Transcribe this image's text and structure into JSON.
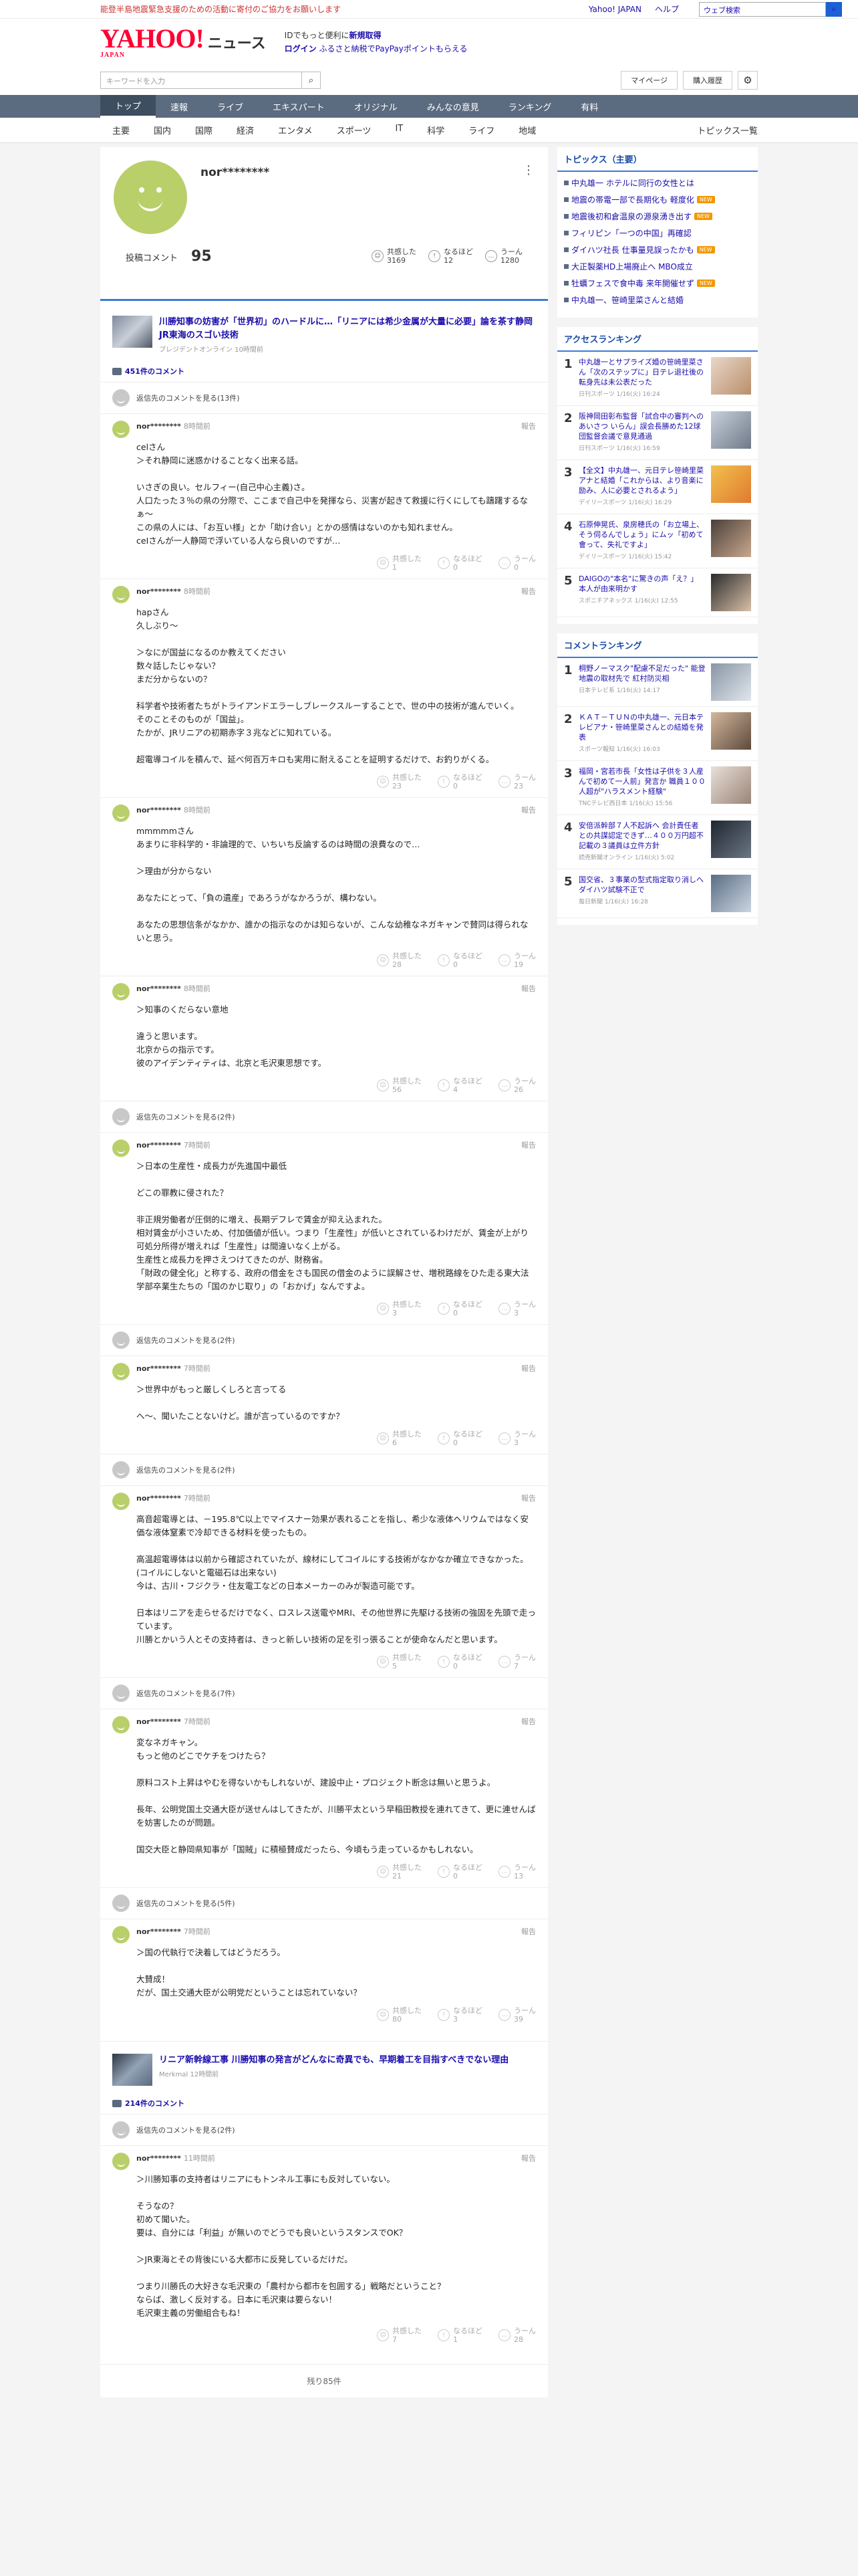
{
  "topbar": {
    "alert": "能登半島地震緊急支援のための活動に寄付のご協力をお願いします",
    "links": [
      "Yahoo! JAPAN",
      "ヘルプ"
    ],
    "search_placeholder": "ウェブ検索"
  },
  "header": {
    "logo": "YAHOO!",
    "logo_sub": "JAPAN",
    "service": "ニュース",
    "promo1": "IDでもっと便利に",
    "promo1b": "新規取得",
    "promo2": "ログイン",
    "promo2b": "ふるさと納税でPayPayポイントもらえる"
  },
  "search": {
    "placeholder": "キーワードを入力",
    "mypage": "マイページ",
    "history": "購入履歴"
  },
  "nav1": [
    "トップ",
    "速報",
    "ライブ",
    "エキスパート",
    "オリジナル",
    "みんなの意見",
    "ランキング",
    "有料"
  ],
  "nav2": [
    "主要",
    "国内",
    "国際",
    "経済",
    "エンタメ",
    "スポーツ",
    "IT",
    "科学",
    "ライフ",
    "地域"
  ],
  "nav2_all": "トピックス一覧",
  "profile": {
    "name": "nor********",
    "posted_label": "投稿コメント",
    "posted": "95",
    "r1": "共感した",
    "r1v": "3169",
    "r2": "なるほど",
    "r2v": "12",
    "r3": "うーん",
    "r3v": "1280"
  },
  "article1": {
    "title": "川勝知事の妨害が「世界初」のハードルに…「リニアには希少金属が大量に必要」論を茶す静岡JR東海のスゴい技術",
    "source": "プレジデントオンライン 10時間前",
    "count": "451件のコメント"
  },
  "parent_label": "返信先のコメントを見る",
  "parents": [
    "(13件)",
    "(2件)",
    "(2件)",
    "(2件)",
    "(7件)",
    "(5件)"
  ],
  "react_labels": [
    "共感した",
    "なるほど",
    "うーん"
  ],
  "report": "報告",
  "comments": [
    {
      "name": "nor********",
      "time": "8時間前",
      "text": "celさん\n＞それ静岡に迷惑かけることなく出来る話。\n\nいさぎの良い。セルフィー(自己中心主義)さ。\n人口たった３％の県の分際で、ここまで自己中を発揮なら、災害が起きて救援に行くにしても躊躇するなぁ〜\nこの県の人には、「お互い様」とか「助け合い」とかの感情はないのかも知れません。\nceIさんが一人静岡で浮いている人なら良いのですが…",
      "r": [
        "1",
        "0",
        "0"
      ]
    },
    {
      "name": "nor********",
      "time": "8時間前",
      "text": "hapさん\n久しぶり〜\n\n＞なにが国益になるのか教えてください\n数々話したじゃない？\nまだ分からないの？\n\n科学者や技術者たちがトライアンドエラーしブレークスルーすることで、世の中の技術が進んでいく。\nそのことそのものが「国益」。\nたかが、JRリニアの初期赤字３兆などに知れている。\n\n超電導コイルを積んで、延べ何百万キロも実用に耐えることを証明するだけで、お釣りがくる。",
      "r": [
        "23",
        "0",
        "23"
      ]
    },
    {
      "name": "nor********",
      "time": "8時間前",
      "text": "mmmmmさん\nあまりに非科学的・非論理的で、いちいち反論するのは時間の浪費なので…\n\n＞理由が分からない\n\nあなたにとって、「負の遺産」であろうがなかろうが、構わない。\n\nあなたの思想信条がなかか、誰かの指示なのかは知らないが、こんな幼稚なネガキャンで賛同は得られないと思う。",
      "r": [
        "28",
        "0",
        "19"
      ]
    },
    {
      "name": "nor********",
      "time": "8時間前",
      "text": "＞知事のくだらない意地\n\n違うと思います。\n北京からの指示です。\n彼のアイデンティティは、北京と毛沢東思想です。",
      "r": [
        "56",
        "4",
        "26"
      ]
    },
    {
      "name": "nor********",
      "time": "7時間前",
      "text": "＞日本の生産性・成長力が先進国中最低\n\nどこの罪教に侵された？\n\n非正規労働者が圧倒的に増え、長期デフレで賃金が抑え込まれた。\n相対賃金が小さいため、付加価値が低い。つまり「生産性」が低いとされているわけだが、賃金が上がり可処分所得が増えれば「生産性」は間違いなく上がる。\n生産性と成長力を押さえつけてきたのが、財務省。\n「財政の健全化」と称する、政府の借金をさも国民の借金のように誤解させ、増税路線をひた走る東大法学部卒業生たちの「国のかじ取り」の「おかげ」なんですよ。",
      "r": [
        "3",
        "0",
        "3"
      ]
    },
    {
      "name": "nor********",
      "time": "7時間前",
      "text": "＞世界中がもっと厳しくしろと言ってる\n\nへ〜、聞いたことないけど。誰が言っているのですか？",
      "r": [
        "6",
        "0",
        "3"
      ]
    },
    {
      "name": "nor********",
      "time": "7時間前",
      "text": "高音超電導とは、－195.8℃以上でマイスナー効果が表れることを指し、希少な液体ヘリウムではなく安価な液体窒素で冷却できる材料を使ったもの。\n\n高温超電導体は以前から確認されていたが、線材にしてコイルにする技術がなかなか確立できなかった。(コイルにしないと電磁石は出来ない)\n今は、古川・フジクラ・住友電工などの日本メーカーのみが製造可能です。\n\n日本はリニアを走らせるだけでなく、ロスレス送電やMRI、その他世界に先駆ける技術の強固を先頭で走っています。\n川勝とかいう人とその支持者は、きっと新しい技術の足を引っ張ることが使命なんだと思います。",
      "r": [
        "5",
        "0",
        "7"
      ]
    },
    {
      "name": "nor********",
      "time": "7時間前",
      "text": "変なネガキャン。\nもっと他のどこでケチをつけたら？\n\n原料コスト上昇はやむを得ないかもしれないが、建設中止・プロジェクト断念は無いと思うよ。\n\n長年、公明党国土交通大臣が送せんはしてきたが、川勝平太という早稲田教授を連れてきて、更に連せんばを妨害したのが問題。\n\n国交大臣と静岡県知事が「国賊」に積極賛成だったら、今頃もう走っているかもしれない。",
      "r": [
        "21",
        "0",
        "13"
      ]
    },
    {
      "name": "nor********",
      "time": "7時間前",
      "text": "＞国の代執行で決着してはどうだろう。\n\n大賛成！\nだが、国土交通大臣が公明党だということは忘れていない？",
      "r": [
        "80",
        "3",
        "39"
      ]
    },
    {
      "name": "nor********",
      "time": "11時間前",
      "text": "＞川勝知事の支持者はリニアにもトンネル工事にも反対していない。\n\nそうなの？\n初めて聞いた。\n要は、自分には「利益」が無いのでどうでも良いというスタンスでOK？\n\n＞JR東海とその背後にいる大都市に反発しているだけだ。\n\nつまり川勝氏の大好きな毛沢東の「農村から都市を包囲する」戦略だということ？\nならば、激しく反対する。日本に毛沢東は要らない！\n毛沢東主義の労働組合もね！",
      "r": [
        "7",
        "1",
        "28"
      ]
    }
  ],
  "article2": {
    "title": "リニア新幹線工事 川勝知事の発言がどんなに奇異でも、早期着工を目指すべきでない理由",
    "source": "Merkmal 12時間前",
    "count": "214件のコメント"
  },
  "more": "残り85件",
  "sidebar": {
    "topics_title": "トピックス（主要）",
    "topics": [
      {
        "t": "中丸雄一 ホテルに同行の女性とは",
        "n": false
      },
      {
        "t": "地震の帯電一部で長期化も 軽度化",
        "n": true
      },
      {
        "t": "地震後初和倉温泉の源泉湧き出す",
        "n": true
      },
      {
        "t": "フィリピン「一つの中国」再確認",
        "n": false
      },
      {
        "t": "ダイハツ社長 仕事量見誤ったかも",
        "n": true
      },
      {
        "t": "大正製薬HD上場廃止へ MBO成立",
        "n": false
      },
      {
        "t": "牡蠣フェスで食中毒 来年開催せず",
        "n": true
      },
      {
        "t": "中丸雄一、笹崎里菜さんと結婚",
        "n": false
      }
    ],
    "access_title": "アクセスランキング",
    "access": [
      {
        "t": "中丸雄一とサプライズ婚の笹崎里菜さん「次のステップに」日テレ退社後の転身先は未公表だった",
        "m": "日刊スポーツ 1/16(火) 16:24"
      },
      {
        "t": "阪神岡田彰布監督「試合中の審判へのあいさつ いらん」誤会長勝めた12球団監督会議で意見通過",
        "m": "日刊スポーツ 1/16(火) 16:59"
      },
      {
        "t": "【全文】中丸雄一、元日テレ笹崎里菜アナと結婚「これからは、より音楽に励み、人に必要とされるよう」",
        "m": "デイリースポーツ 1/16(火) 16:29"
      },
      {
        "t": "石原伸晃氏、泉房穂氏の「お立場上、そう伺るんでしょう」にムッ「初めて會って、失礼ですよ」",
        "m": "デイリースポーツ 1/16(火) 15:42"
      },
      {
        "t": "DAIGOの\"本名\"に驚きの声「え？」 本人が由来明かす",
        "m": "スポニチアネックス 1/16(火) 12:55"
      }
    ],
    "comment_title": "コメントランキング",
    "crank": [
      {
        "t": "桐野ノーマスク\"配慮不足だった\" 能登地震の取材先で 紅村防災相",
        "m": "日本テレビ系 1/16(火) 14:17"
      },
      {
        "t": "ＫＡＴ－ＴＵＮの中丸雄一、元日本テレビアナ・笹崎里菜さんとの結婚を発表",
        "m": "スポーツ報知 1/16(火) 16:03"
      },
      {
        "t": "福岡・宮若市長「女性は子供を３人産んで初めて一人前」発言か 職員１００人超が\"ハラスメント経験\"",
        "m": "TNCテレビ西日本 1/16(火) 15:56"
      },
      {
        "t": "安倍派幹部７人不起訴へ 会計責任者との共謀認定できず…４００万円超不記載の３議員は立件方針",
        "m": "読売新聞オンライン 1/16(火) 5:02"
      },
      {
        "t": "国交省、３事業の型式指定取り消しへ ダイハツ試験不正で",
        "m": "毎日新聞 1/16(火) 16:28"
      }
    ]
  }
}
